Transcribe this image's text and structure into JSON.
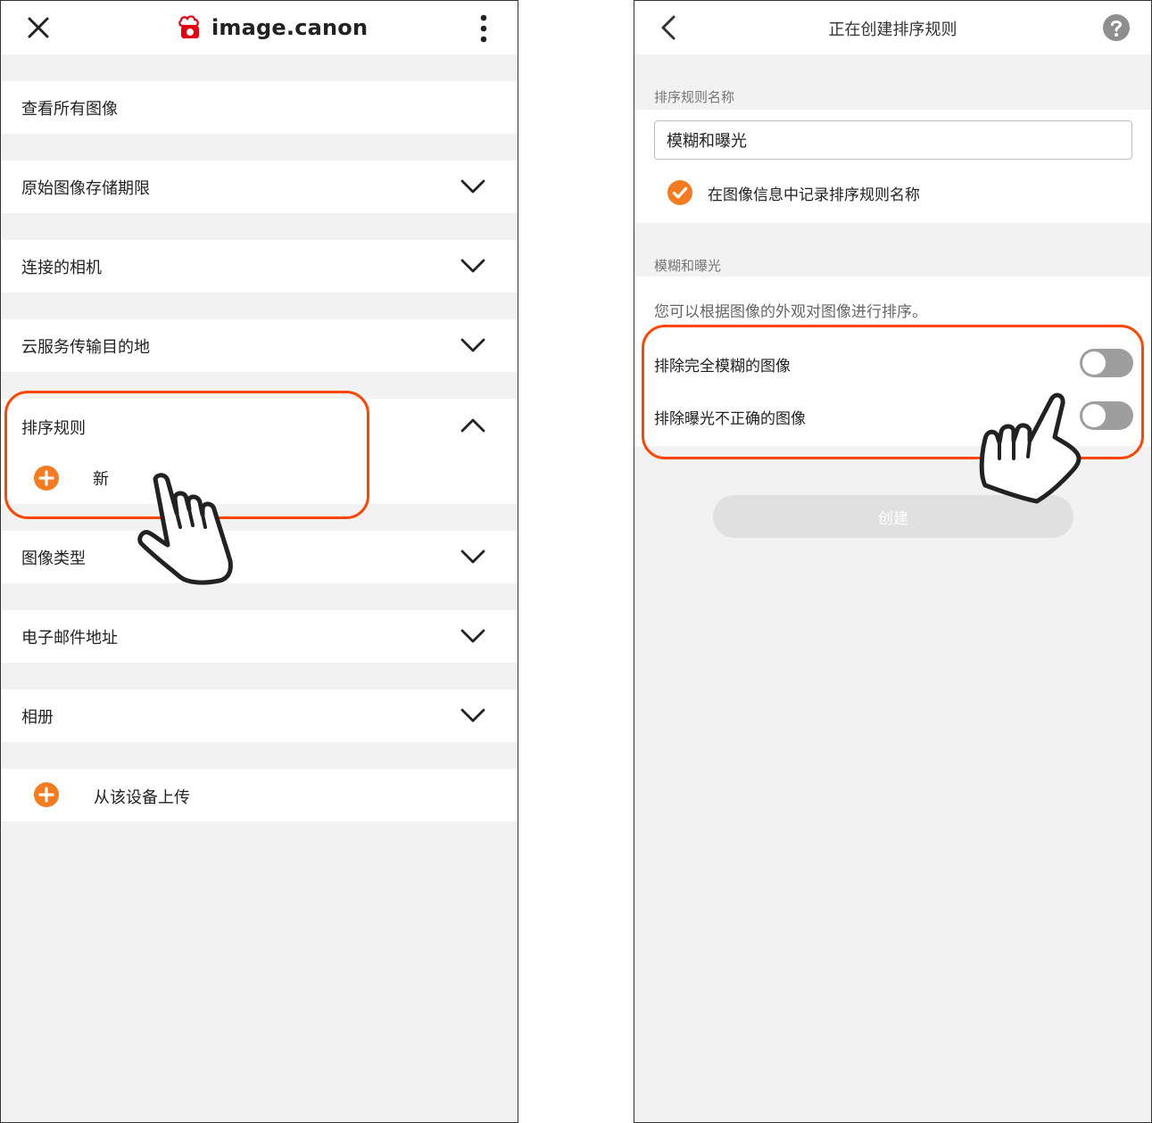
{
  "left_panel": {
    "app_name": "image.canon",
    "items": [
      {
        "label": "查看所有图像"
      },
      {
        "label": "原始图像存储期限"
      },
      {
        "label": "连接的相机"
      },
      {
        "label": "云服务传输目的地"
      },
      {
        "label": "排序规则",
        "sub_item": "新"
      },
      {
        "label": "图像类型"
      },
      {
        "label": "电子邮件地址"
      },
      {
        "label": "相册"
      }
    ],
    "upload_label": "从该设备上传"
  },
  "right_panel": {
    "title": "正在创建排序规则",
    "name_section_label": "排序规则名称",
    "name_value": "模糊和曝光",
    "record_name_label": "在图像信息中记录排序规则名称",
    "record_name_checked": true,
    "rule_section_label": "模糊和曝光",
    "description": "您可以根据图像的外观对图像进行排序。",
    "toggles": [
      {
        "label": "排除完全模糊的图像",
        "on": false
      },
      {
        "label": "排除曝光不正确的图像",
        "on": false
      }
    ],
    "create_label": "创建"
  },
  "colors": {
    "accent_orange": "#f47b20",
    "highlight_red": "#ff4500",
    "logo_red": "#e60012",
    "separator_gray": "#f2f2f2",
    "toggle_off": "#9e9e9e"
  }
}
